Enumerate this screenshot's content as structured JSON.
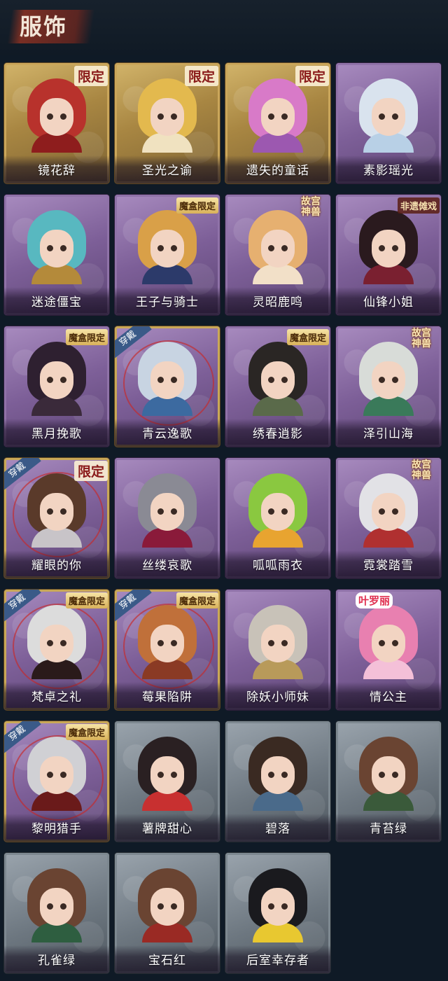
{
  "header": {
    "title": "服饰"
  },
  "badges": {
    "limited": "限定",
    "mohe": "魔盒限定",
    "gugong": "故宫神兽",
    "feiyi": "非遗傩戏",
    "yeluoli": "叶罗丽",
    "worn": "穿戴"
  },
  "costumes": [
    {
      "name": "镜花辞",
      "frame": "gold",
      "badge": "limited",
      "worn": false,
      "hair": "#b8322c",
      "outfit": "#8e1d1d"
    },
    {
      "name": "圣光之谕",
      "frame": "gold",
      "badge": "limited",
      "worn": false,
      "hair": "#e3b94e",
      "outfit": "#f0e2c0"
    },
    {
      "name": "遗失的童话",
      "frame": "gold",
      "badge": "limited",
      "worn": false,
      "hair": "#d87ac8",
      "outfit": "#9c58b0"
    },
    {
      "name": "素影瑶光",
      "frame": "purple",
      "badge": "",
      "worn": false,
      "hair": "#d9e3ee",
      "outfit": "#b8d0e6"
    },
    {
      "name": "迷途僵宝",
      "frame": "purple",
      "badge": "",
      "worn": false,
      "hair": "#58b8c0",
      "outfit": "#b48a3a"
    },
    {
      "name": "王子与骑士",
      "frame": "purple",
      "badge": "mohe",
      "worn": false,
      "hair": "#d9a048",
      "outfit": "#2c3a6a"
    },
    {
      "name": "灵昭鹿鸣",
      "frame": "purple",
      "badge": "gugong",
      "worn": false,
      "hair": "#e6b070",
      "outfit": "#f2e0c8"
    },
    {
      "name": "仙锋小姐",
      "frame": "purple",
      "badge": "feiyi",
      "worn": false,
      "hair": "#2a1a1e",
      "outfit": "#7a2030"
    },
    {
      "name": "黑月挽歌",
      "frame": "purple",
      "badge": "mohe",
      "worn": false,
      "hair": "#2e2030",
      "outfit": "#3a2a3a"
    },
    {
      "name": "青云逸歌",
      "frame": "purple",
      "badge": "",
      "worn": true,
      "hair": "#c8d4e2",
      "outfit": "#3c6aa0"
    },
    {
      "name": "绣春逍影",
      "frame": "purple",
      "badge": "mohe",
      "worn": false,
      "hair": "#2a2624",
      "outfit": "#5a6a4a"
    },
    {
      "name": "泽引山海",
      "frame": "purple",
      "badge": "gugong",
      "worn": false,
      "hair": "#d8dcd8",
      "outfit": "#3a7a5a"
    },
    {
      "name": "耀眼的你",
      "frame": "purple",
      "badge": "limited",
      "worn": true,
      "hair": "#5a3a2a",
      "outfit": "#c8c4c8"
    },
    {
      "name": "丝缕哀歌",
      "frame": "purple",
      "badge": "",
      "worn": false,
      "hair": "#8a8a94",
      "outfit": "#8a1a3a"
    },
    {
      "name": "呱呱雨衣",
      "frame": "purple",
      "badge": "",
      "worn": false,
      "hair": "#8ac840",
      "outfit": "#e8a430"
    },
    {
      "name": "霓裳踏雪",
      "frame": "purple",
      "badge": "gugong",
      "worn": false,
      "hair": "#e2e2e6",
      "outfit": "#b03030"
    },
    {
      "name": "梵卓之礼",
      "frame": "purple",
      "badge": "mohe",
      "worn": true,
      "hair": "#dcdcdc",
      "outfit": "#2a1a1a"
    },
    {
      "name": "莓果陷阱",
      "frame": "purple",
      "badge": "mohe",
      "worn": true,
      "hair": "#c0703a",
      "outfit": "#8a3a24"
    },
    {
      "name": "除妖小师妹",
      "frame": "purple",
      "badge": "",
      "worn": false,
      "hair": "#c8c2b8",
      "outfit": "#b89a5a"
    },
    {
      "name": "情公主",
      "frame": "purple",
      "badge": "yeluoli",
      "worn": false,
      "hair": "#e880b0",
      "outfit": "#f4c0d8"
    },
    {
      "name": "黎明猎手",
      "frame": "purple",
      "badge": "mohe",
      "worn": true,
      "hair": "#d0d0d4",
      "outfit": "#6a1a1a"
    },
    {
      "name": "薯牌甜心",
      "frame": "gray",
      "badge": "",
      "worn": false,
      "hair": "#2a2022",
      "outfit": "#c83030"
    },
    {
      "name": "碧落",
      "frame": "gray",
      "badge": "",
      "worn": false,
      "hair": "#3a2a22",
      "outfit": "#4a6a8a"
    },
    {
      "name": "青苔绿",
      "frame": "gray",
      "badge": "",
      "worn": false,
      "hair": "#6a4432",
      "outfit": "#3a5a3a"
    },
    {
      "name": "孔雀绿",
      "frame": "gray",
      "badge": "",
      "worn": false,
      "hair": "#6a4432",
      "outfit": "#2e5e40"
    },
    {
      "name": "宝石红",
      "frame": "gray",
      "badge": "",
      "worn": false,
      "hair": "#6a4432",
      "outfit": "#9a2a24"
    },
    {
      "name": "后室幸存者",
      "frame": "gray",
      "badge": "",
      "worn": false,
      "hair": "#1a1a1e",
      "outfit": "#e8c830"
    }
  ]
}
